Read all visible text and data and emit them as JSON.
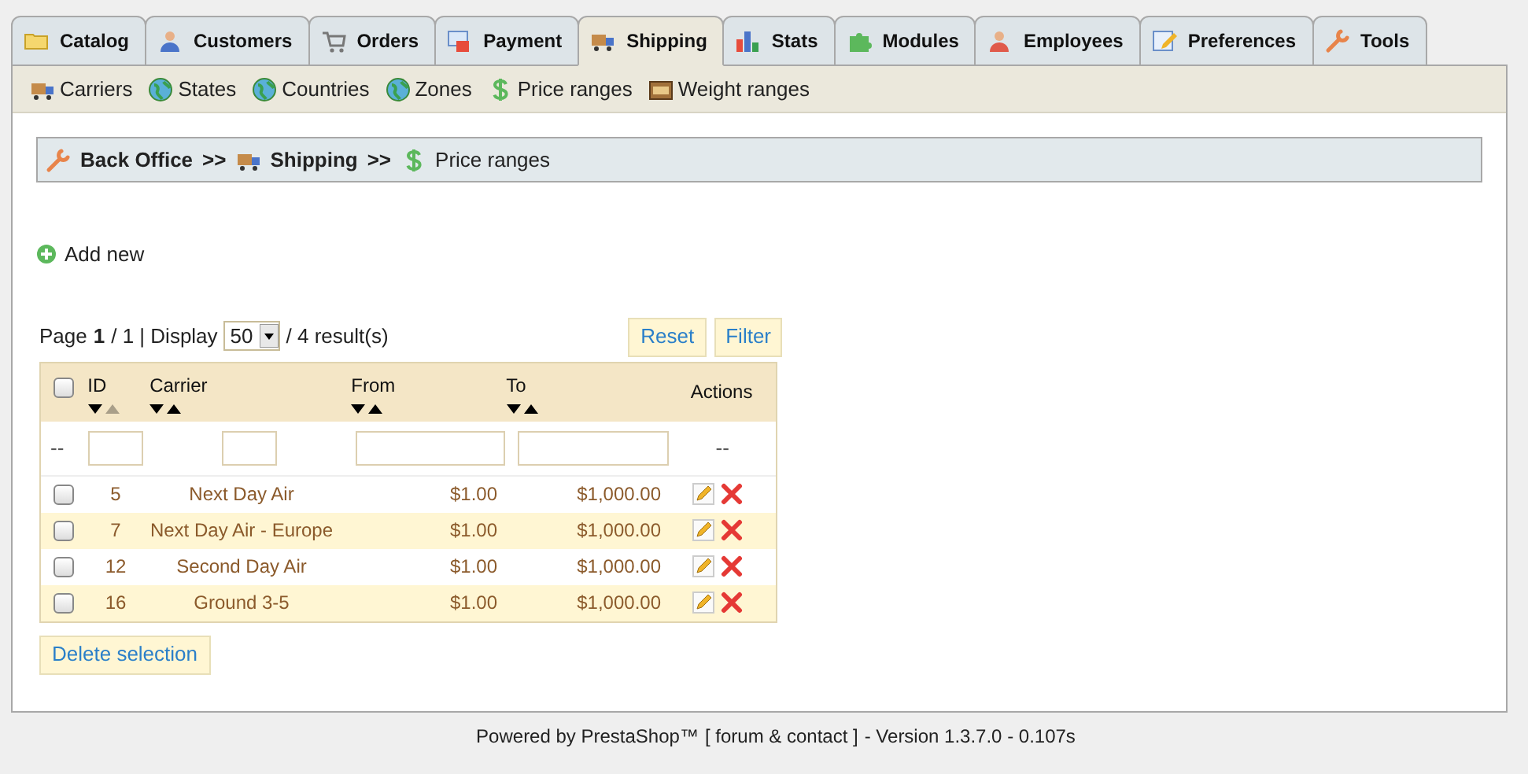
{
  "tabs": [
    {
      "label": "Catalog",
      "selected": false
    },
    {
      "label": "Customers",
      "selected": false
    },
    {
      "label": "Orders",
      "selected": false
    },
    {
      "label": "Payment",
      "selected": false
    },
    {
      "label": "Shipping",
      "selected": true
    },
    {
      "label": "Stats",
      "selected": false
    },
    {
      "label": "Modules",
      "selected": false
    },
    {
      "label": "Employees",
      "selected": false
    },
    {
      "label": "Preferences",
      "selected": false
    },
    {
      "label": "Tools",
      "selected": false
    }
  ],
  "subnav": [
    "Carriers",
    "States",
    "Countries",
    "Zones",
    "Price ranges",
    "Weight ranges"
  ],
  "breadcrumb": [
    "Back Office",
    ">>",
    "Shipping",
    ">>",
    "Price ranges"
  ],
  "add_new": "Add new",
  "pagination": {
    "page_label": "Page",
    "page": "1",
    "of": "/ 1 | Display",
    "display": "50",
    "results": "/ 4 result(s)"
  },
  "buttons": {
    "reset": "Reset",
    "filter": "Filter",
    "delete": "Delete selection"
  },
  "table": {
    "select_all_checked": false,
    "columns": [
      {
        "label": "ID",
        "sorted_asc": true
      },
      {
        "label": "Carrier",
        "sorted_asc": false
      },
      {
        "label": "From",
        "sorted_asc": false
      },
      {
        "label": "To",
        "sorted_asc": false
      }
    ],
    "actions_label": "Actions",
    "filter_row": {
      "left": "--",
      "right": "--"
    },
    "rows": [
      {
        "checked": false,
        "id": "5",
        "carrier": "Next Day Air",
        "from": "$1.00",
        "to": "$1,000.00"
      },
      {
        "checked": false,
        "id": "7",
        "carrier": "Next Day Air - Europe",
        "from": "$1.00",
        "to": "$1,000.00"
      },
      {
        "checked": false,
        "id": "12",
        "carrier": "Second Day Air",
        "from": "$1.00",
        "to": "$1,000.00"
      },
      {
        "checked": false,
        "id": "16",
        "carrier": "Ground 3-5",
        "from": "$1.00",
        "to": "$1,000.00"
      }
    ]
  },
  "footer": {
    "text": "Powered by PrestaShop™",
    "link": "[ forum & contact ]",
    "version": "- Version 1.3.7.0 - 0.107s"
  }
}
